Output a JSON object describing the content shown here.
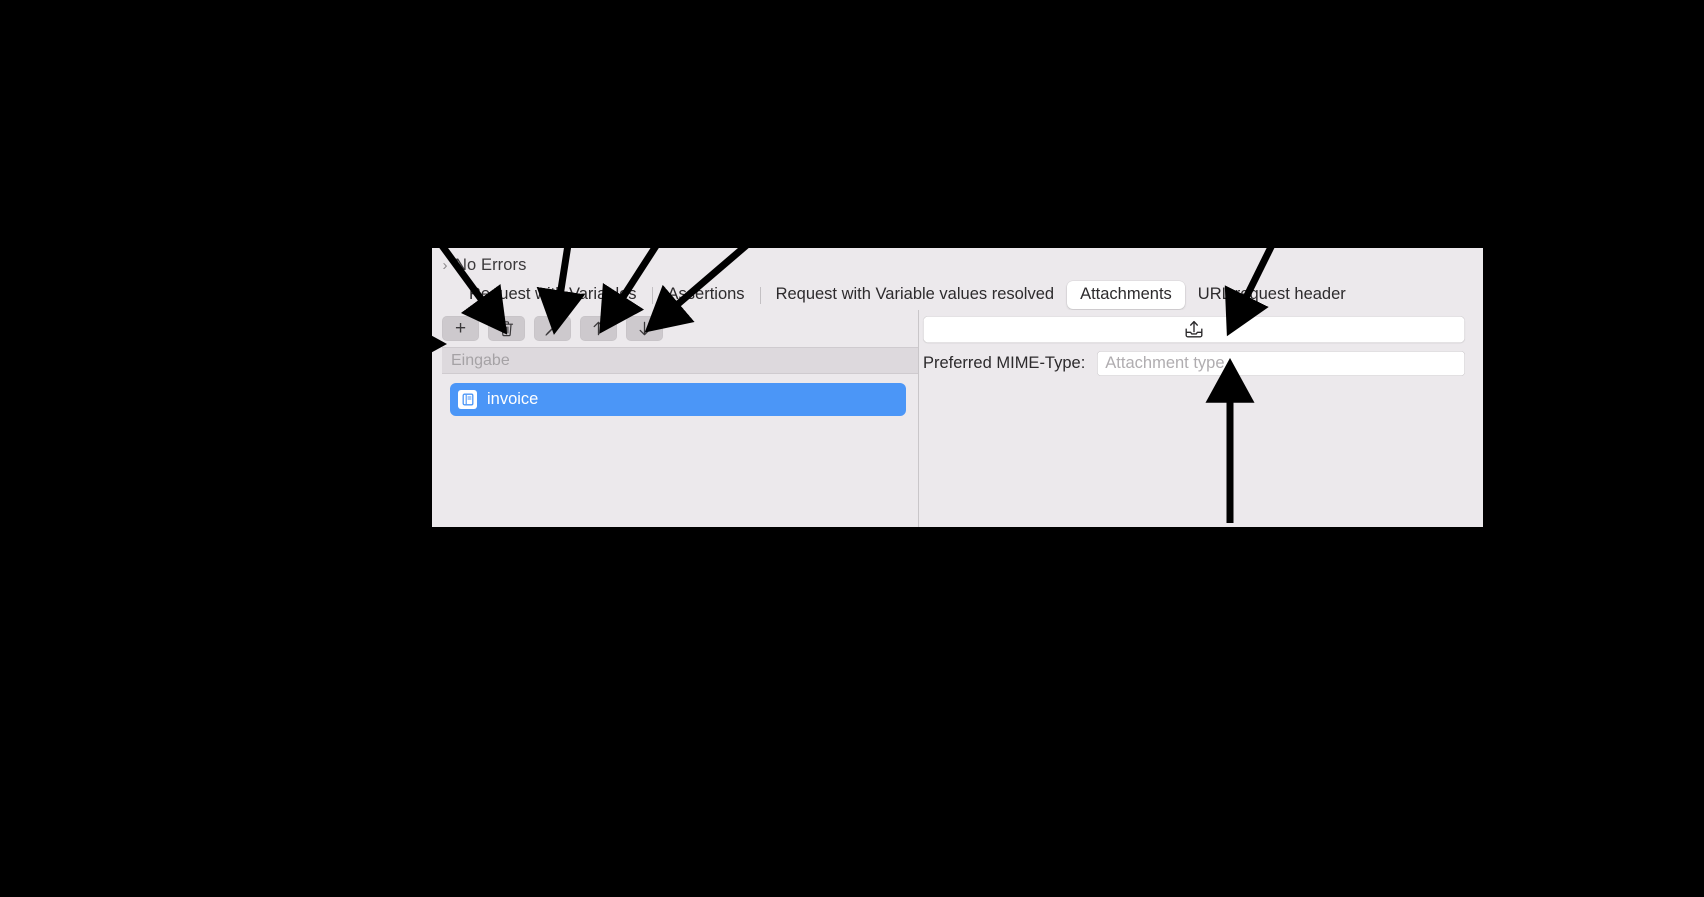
{
  "window": {
    "errors": {
      "disclosure_glyph": "›",
      "label": "No Errors"
    },
    "tabs": [
      {
        "label": "Request with Variables",
        "selected": false
      },
      {
        "label": "Assertions",
        "selected": false
      },
      {
        "label": "Request with Variable values resolved",
        "selected": false
      },
      {
        "label": "Attachments",
        "selected": true
      },
      {
        "label": "URL request header",
        "selected": false
      }
    ],
    "toolbar": {
      "buttons": [
        {
          "name": "add-attachment-button",
          "icon": "plus-icon",
          "label": "+"
        },
        {
          "name": "delete-attachment-button",
          "icon": "trash-icon",
          "label": ""
        },
        {
          "name": "edit-attachment-button",
          "icon": "pencil-icon",
          "label": ""
        },
        {
          "name": "move-up-button",
          "icon": "arrow-up-icon",
          "label": ""
        },
        {
          "name": "move-down-button",
          "icon": "arrow-down-icon",
          "label": ""
        }
      ]
    },
    "attachment_list": {
      "header": "Eingabe",
      "rows": [
        {
          "label": "invoice",
          "icon": "document-icon",
          "selected": true
        }
      ]
    },
    "attachment_detail": {
      "drop_field": {
        "value": "",
        "icon": "export-tray-up-icon"
      },
      "mime_type": {
        "label": "Preferred MIME-Type:",
        "value": "",
        "placeholder": "Attachment type"
      }
    }
  },
  "colors": {
    "background": "#000000",
    "window_chrome": "#ece9ec",
    "selection_blue": "#4b96f7",
    "tab_selected_bg": "#ffffff",
    "toolbar_button_bg": "#cdc9cd",
    "list_header_bg": "#ddd9dd",
    "annotation_arrow": "#000000"
  },
  "annotations": {
    "arrows": [
      {
        "name": "arrow-to-add-button",
        "target": "add-attachment-button"
      },
      {
        "name": "arrow-to-delete-button",
        "target": "delete-attachment-button"
      },
      {
        "name": "arrow-to-edit-button",
        "target": "edit-attachment-button"
      },
      {
        "name": "arrow-to-move-up-button",
        "target": "move-up-button"
      },
      {
        "name": "arrow-to-move-down-button",
        "target": "move-down-button"
      },
      {
        "name": "arrow-to-export-icon",
        "target": "export-tray-up-icon"
      },
      {
        "name": "arrow-to-mime-input",
        "target": "mime-type-input"
      }
    ]
  }
}
